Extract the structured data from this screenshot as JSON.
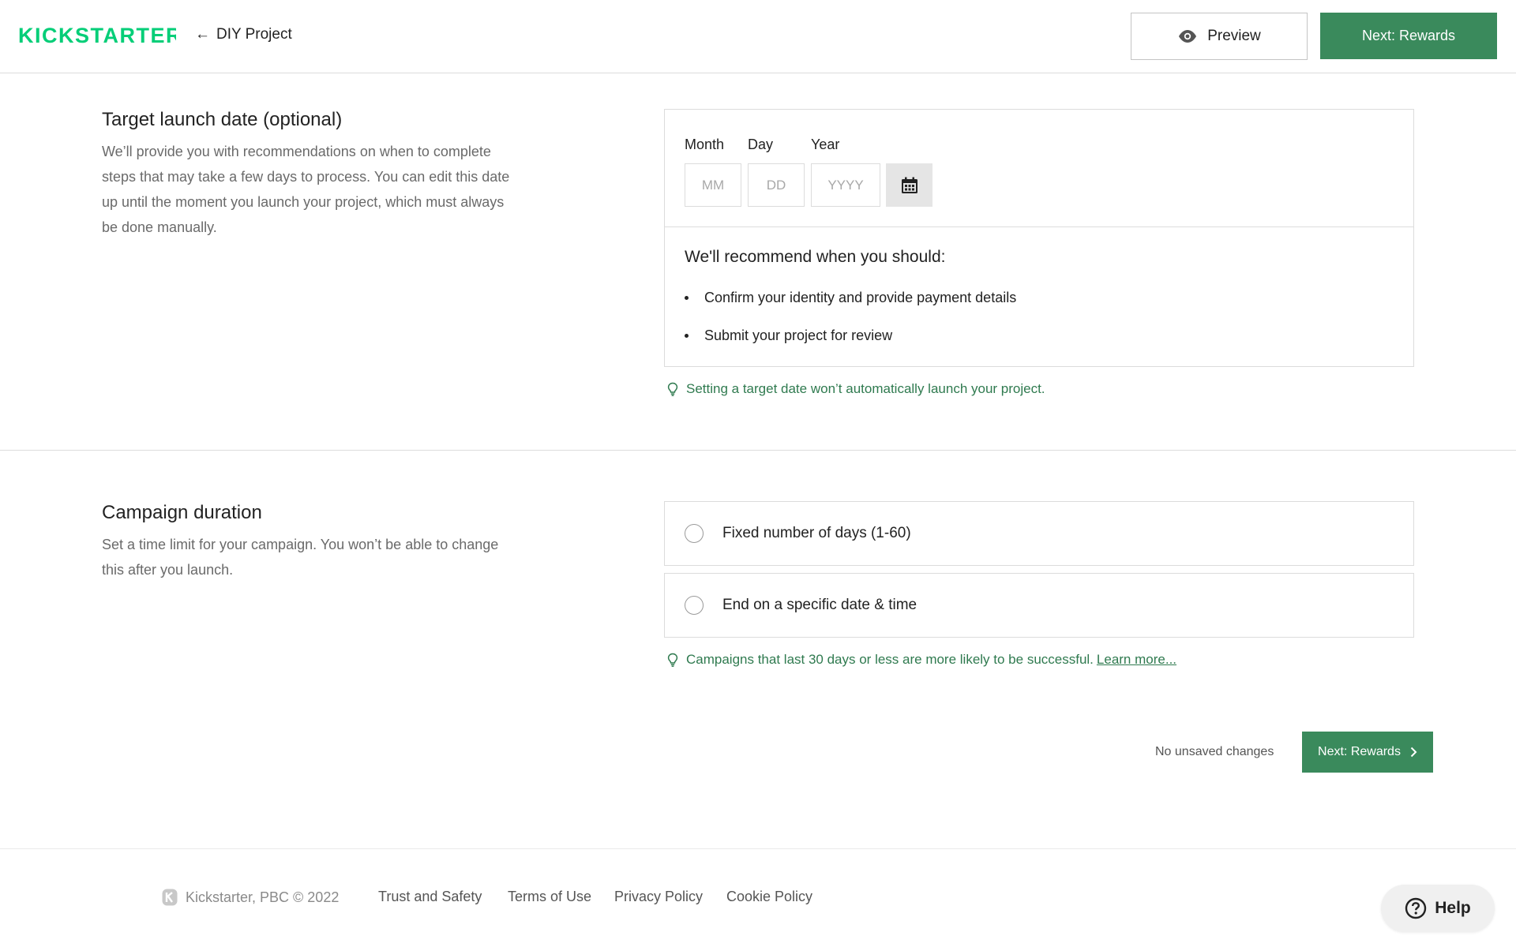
{
  "header": {
    "logo_text": "KICKSTARTER",
    "back_label": "DIY Project",
    "preview_label": "Preview",
    "next_label": "Next: Rewards"
  },
  "colors": {
    "brand_green": "#05ce78",
    "button_green": "#3a8a5c",
    "tip_green": "#2f7a4f"
  },
  "launch_date": {
    "title": "Target launch date (optional)",
    "description": "We’ll provide you with recommendations on when to complete steps that may take a few days to process. You can edit this date up until the moment you launch your project, which must always be done manually.",
    "month_label": "Month",
    "day_label": "Day",
    "year_label": "Year",
    "month_value": "",
    "day_value": "",
    "year_value": "",
    "month_placeholder": "MM",
    "day_placeholder": "DD",
    "year_placeholder": "YYYY",
    "calendar_icon": "calendar-icon",
    "recommend_title": "We'll recommend when you should:",
    "recommend_items": [
      "Confirm your identity and provide payment details",
      "Submit your project for review"
    ],
    "tip": "Setting a target date won’t automatically launch your project."
  },
  "duration": {
    "title": "Campaign duration",
    "description": "Set a time limit for your campaign. You won’t be able to change this after you launch.",
    "options": [
      {
        "label": "Fixed number of days (1-60)",
        "selected": false
      },
      {
        "label": "End on a specific date & time",
        "selected": false
      }
    ],
    "tip": "Campaigns that last 30 days or less are more likely to be successful.",
    "tip_link": "Learn more..."
  },
  "save_bar": {
    "status": "No unsaved changes",
    "next_label": "Next: Rewards"
  },
  "footer": {
    "copyright": "Kickstarter, PBC © 2022",
    "links": [
      "Trust and Safety",
      "Terms of Use",
      "Privacy Policy",
      "Cookie Policy"
    ],
    "help_label": "Help"
  }
}
